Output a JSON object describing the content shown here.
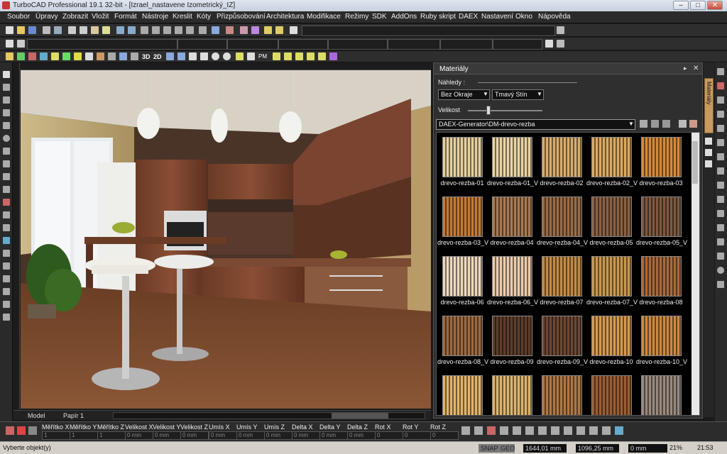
{
  "window": {
    "title": "TurboCAD Professional 19.1 32-bit - [Izrael_nastavene Izometrický_IZ]"
  },
  "menu": [
    "Soubor",
    "Úpravy",
    "Zobrazit",
    "Vložit",
    "Formát",
    "Nástroje",
    "Kreslit",
    "Kóty",
    "Přizpůsobování",
    "Architektura",
    "Modifikace",
    "Režimy",
    "SDK",
    "AddOns",
    "Ruby skript",
    "DAEX",
    "Nastavení",
    "Okno",
    "Nápověda"
  ],
  "toolbar3": {
    "label_3d": "3D",
    "label_2d": "2D",
    "label_pm": "PM"
  },
  "view_tabs": {
    "model": "Model",
    "paper": "Papír 1"
  },
  "panel": {
    "title": "Materiály",
    "side_tab": "Materiály",
    "previews_label": "Náhledy :",
    "edge_select": "Bez Okraje",
    "shadow_select": "Tmavý Stín",
    "size_label": "Velikost",
    "path": "DAEX-Generator\\DM-drevo-rezba",
    "materials": [
      {
        "name": "drevo-rezba-01",
        "color": "#e6cf9e"
      },
      {
        "name": "drevo-rezba-01_V",
        "color": "#ead4a4"
      },
      {
        "name": "drevo-rezba-02",
        "color": "#d9ac6c"
      },
      {
        "name": "drevo-rezba-02_V",
        "color": "#dcaa62"
      },
      {
        "name": "drevo-rezba-03",
        "color": "#d68a3a"
      },
      {
        "name": "drevo-rezba-03_V",
        "color": "#c47a34"
      },
      {
        "name": "drevo-rezba-04",
        "color": "#a87a52"
      },
      {
        "name": "drevo-rezba-04_V",
        "color": "#9a6c46"
      },
      {
        "name": "drevo-rezba-05",
        "color": "#8a6244"
      },
      {
        "name": "drevo-rezba-05_V",
        "color": "#7e5a40"
      },
      {
        "name": "drevo-rezba-06",
        "color": "#eed8bc"
      },
      {
        "name": "drevo-rezba-06_V",
        "color": "#ecccac"
      },
      {
        "name": "drevo-rezba-07",
        "color": "#c48a44"
      },
      {
        "name": "drevo-rezba-07_V",
        "color": "#c9984e"
      },
      {
        "name": "drevo-rezba-08",
        "color": "#a96a3c"
      },
      {
        "name": "drevo-rezba-08_V",
        "color": "#9e6a40"
      },
      {
        "name": "drevo-rezba-09",
        "color": "#5e3e2c"
      },
      {
        "name": "drevo-rezba-09_V",
        "color": "#6e4834"
      },
      {
        "name": "drevo-rezba-10",
        "color": "#d69a50"
      },
      {
        "name": "drevo-rezba-10_V",
        "color": "#cc8a40"
      },
      {
        "name": "",
        "color": "#e2b46a"
      },
      {
        "name": "",
        "color": "#dcb46e"
      },
      {
        "name": "",
        "color": "#b07844"
      },
      {
        "name": "",
        "color": "#9a5e34"
      },
      {
        "name": "",
        "color": "#9a8a7e"
      }
    ]
  },
  "status_fields": [
    "Měřítko X",
    "Měřítko Y",
    "Měřítko Z",
    "Velikost X",
    "Velikost Y",
    "Velikost Z",
    "Umís X",
    "Umís Y",
    "Umís Z",
    "Delta X",
    "Delta Y",
    "Delta Z",
    "Rot X",
    "Rot Y",
    "Rot Z"
  ],
  "status_values": [
    "1",
    "1",
    "1",
    "0 mm",
    "0 mm",
    "0 mm",
    "0 mm",
    "0 mm",
    "0 mm",
    "0 mm",
    "0 mm",
    "0 mm",
    "0",
    "0",
    "0"
  ],
  "statusbar": {
    "prompt": "Vyberte objekt(y)",
    "snap1": "SNAP",
    "snap2": "GEO",
    "x": "1644,01 mm",
    "y": "1096,25 mm",
    "z": "0 mm",
    "zoom": "21%",
    "time": "21:53"
  }
}
